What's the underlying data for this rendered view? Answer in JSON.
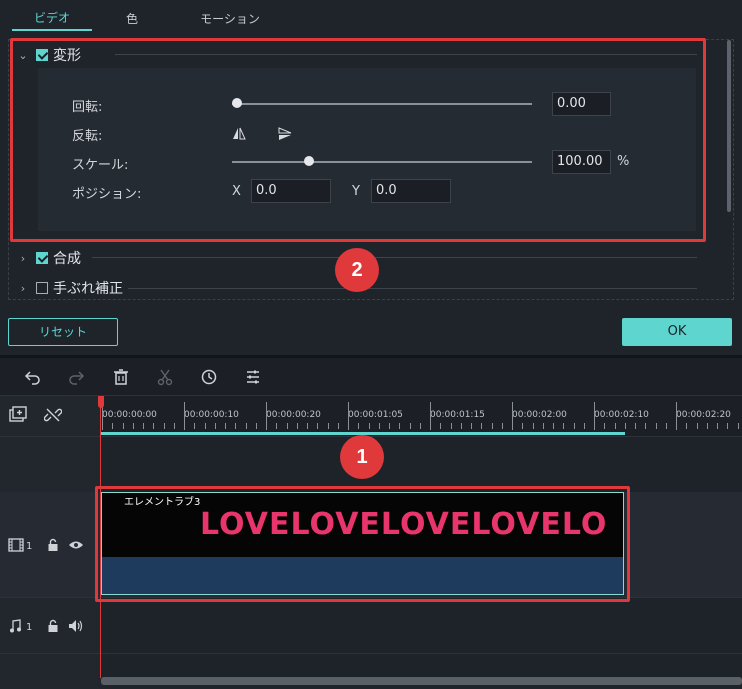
{
  "tabs": [
    {
      "label": "ビデオ",
      "active": true
    },
    {
      "label": "色",
      "active": false
    },
    {
      "label": "モーション",
      "active": false
    }
  ],
  "sections": {
    "transform": {
      "label": "変形",
      "checked": true,
      "expanded": true
    },
    "composite": {
      "label": "合成",
      "checked": true,
      "expanded": false
    },
    "stabilize": {
      "label": "手ぶれ補正",
      "checked": false,
      "expanded": false
    }
  },
  "properties": {
    "rotate": {
      "label": "回転:",
      "value": "0.00",
      "slider_fraction": 0.0
    },
    "flip": {
      "label": "反転:",
      "icons": [
        "flip-horizontal-icon",
        "flip-vertical-icon"
      ]
    },
    "scale": {
      "label": "スケール:",
      "value": "100.00",
      "unit": "%",
      "slider_fraction": 0.25
    },
    "position": {
      "label": "ポジション:",
      "x_label": "X",
      "x_value": "0.0",
      "y_label": "Y",
      "y_value": "0.0"
    }
  },
  "buttons": {
    "reset": "リセット",
    "ok": "OK"
  },
  "badges": {
    "one": "1",
    "two": "2"
  },
  "toolbar_icons": [
    "undo-icon",
    "redo-icon",
    "delete-icon",
    "cut-icon",
    "clock-icon",
    "adjust-icon"
  ],
  "timeline": {
    "ticks": [
      "00:00:00:00",
      "00:00:00:10",
      "00:00:00:20",
      "00:00:01:05",
      "00:00:01:15",
      "00:00:02:00",
      "00:00:02:10",
      "00:00:02:20"
    ],
    "video_track": {
      "number": "1"
    },
    "audio_track": {
      "number": "1"
    },
    "clip": {
      "name": "エレメントラブ3",
      "art_text": "LOVELOVELOVELOVELO"
    }
  },
  "colors": {
    "accent": "#5ed6cf",
    "highlight": "#e0393b",
    "clip_pink": "#e8356b"
  }
}
